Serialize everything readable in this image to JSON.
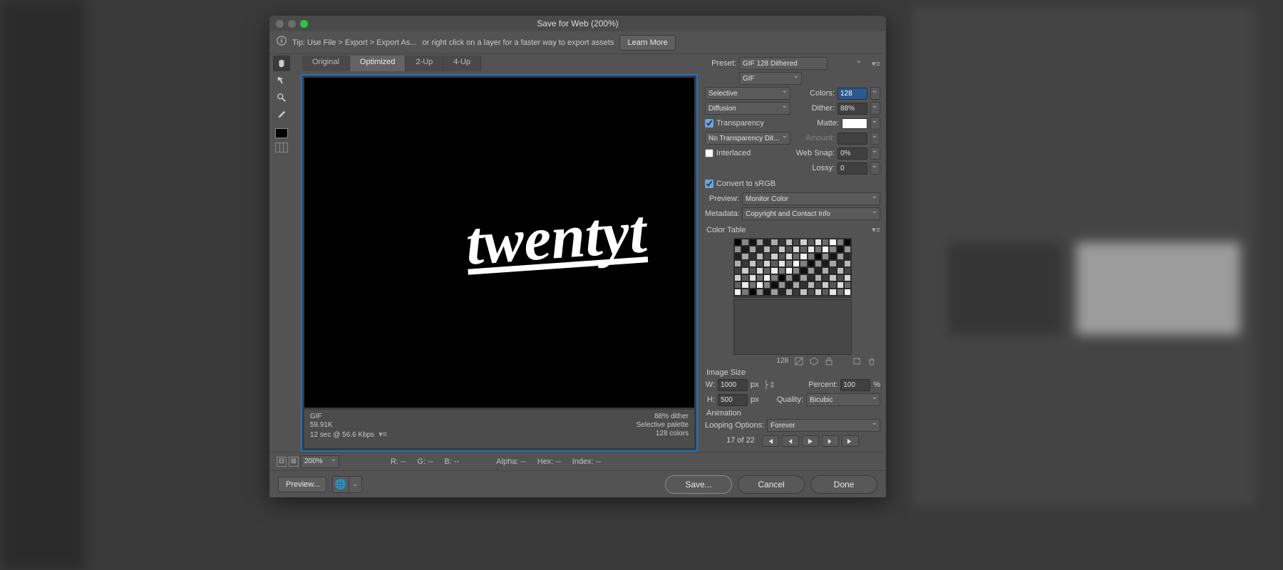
{
  "window": {
    "title": "Save for Web (200%)"
  },
  "tip": {
    "text1": "Tip: Use File > Export > Export As...",
    "text2": "or right click on a layer for a faster way to export assets",
    "learn_more": "Learn More"
  },
  "tabs": {
    "original": "Original",
    "optimized": "Optimized",
    "twoup": "2-Up",
    "fourup": "4-Up"
  },
  "preview_info": {
    "format": "GIF",
    "size": "59.91K",
    "speed": "12 sec @ 56.6 Kbps",
    "dither": "88% dither",
    "palette": "Selective palette",
    "colors": "128 colors"
  },
  "preset": {
    "label": "Preset:",
    "value": "GIF 128 Dithered",
    "format": "GIF",
    "reduction": "Selective",
    "colors_label": "Colors:",
    "colors": "128",
    "dith_method": "Diffusion",
    "dither_label": "Dither:",
    "dither": "88%",
    "transparency": "Transparency",
    "matte_label": "Matte:",
    "trans_dither": "No Transparency Dit...",
    "amount_label": "Amount:",
    "interlaced": "Interlaced",
    "websnap_label": "Web Snap:",
    "websnap": "0%",
    "lossy_label": "Lossy:",
    "lossy": "0",
    "srgb": "Convert to sRGB",
    "preview_label": "Preview:",
    "preview_value": "Monitor Color",
    "metadata_label": "Metadata:",
    "metadata_value": "Copyright and Contact Info"
  },
  "colortable": {
    "label": "Color Table",
    "count": "128"
  },
  "imagesize": {
    "label": "Image Size",
    "w_label": "W:",
    "w": "1000",
    "h_label": "H:",
    "h": "500",
    "px": "px",
    "percent_label": "Percent:",
    "percent": "100",
    "pct": "%",
    "quality_label": "Quality:",
    "quality": "Bicubic"
  },
  "animation": {
    "label": "Animation",
    "loop_label": "Looping Options:",
    "loop": "Forever",
    "frame": "17 of 22"
  },
  "status": {
    "zoom": "200%",
    "r": "R: --",
    "g": "G: --",
    "b": "B: --",
    "alpha": "Alpha: --",
    "hex": "Hex: --",
    "index": "Index: --"
  },
  "buttons": {
    "preview": "Preview...",
    "save": "Save...",
    "cancel": "Cancel",
    "done": "Done"
  },
  "canvas_text": "twentyt"
}
